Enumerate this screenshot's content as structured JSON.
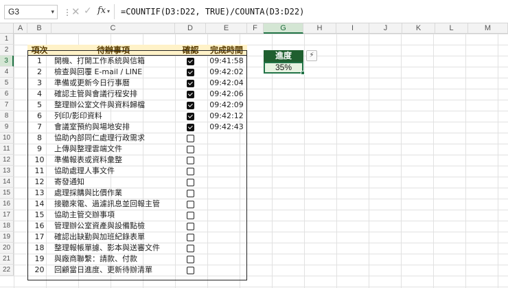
{
  "formula_bar": {
    "name_box": "G3",
    "fx": "fx",
    "formula": "=COUNTIF(D3:D22, TRUE)/COUNTA(D3:D22)"
  },
  "columns": [
    "A",
    "B",
    "C",
    "D",
    "E",
    "F",
    "G",
    "H",
    "I",
    "J",
    "K",
    "L",
    "M"
  ],
  "rows": [
    "1",
    "2",
    "3",
    "4",
    "5",
    "6",
    "7",
    "8",
    "9",
    "10",
    "11",
    "12",
    "13",
    "14",
    "15",
    "16",
    "17",
    "18",
    "19",
    "20",
    "21",
    "22"
  ],
  "table": {
    "headers": {
      "no": "項次",
      "task": "待辦事項",
      "check": "確認",
      "time": "完成時間"
    },
    "items": [
      {
        "no": "1",
        "task": "開機、打開工作系統與信箱",
        "done": true,
        "time": "09:41:58"
      },
      {
        "no": "2",
        "task": "檢查與回覆 E-mail / LINE",
        "done": true,
        "time": "09:42:02"
      },
      {
        "no": "3",
        "task": "準備或更新今日行事曆",
        "done": true,
        "time": "09:42:04"
      },
      {
        "no": "4",
        "task": "確認主管與會議行程安排",
        "done": true,
        "time": "09:42:06"
      },
      {
        "no": "5",
        "task": "整理辦公室文件與資料歸檔",
        "done": true,
        "time": "09:42:09"
      },
      {
        "no": "6",
        "task": "列印/影印資料",
        "done": true,
        "time": "09:42:12"
      },
      {
        "no": "7",
        "task": "會議室預約與場地安排",
        "done": true,
        "time": "09:42:43"
      },
      {
        "no": "8",
        "task": "協助內部同仁處理行政需求",
        "done": false,
        "time": ""
      },
      {
        "no": "9",
        "task": "上傳與整理雲端文件",
        "done": false,
        "time": ""
      },
      {
        "no": "10",
        "task": "準備報表或資料彙整",
        "done": false,
        "time": ""
      },
      {
        "no": "11",
        "task": "協助處理人事文件",
        "done": false,
        "time": ""
      },
      {
        "no": "12",
        "task": "寄發通知",
        "done": false,
        "time": ""
      },
      {
        "no": "13",
        "task": "處理採購與比價作業",
        "done": false,
        "time": ""
      },
      {
        "no": "14",
        "task": "接聽來電、過濾訊息並回報主管",
        "done": false,
        "time": ""
      },
      {
        "no": "15",
        "task": "協助主管交辦事項",
        "done": false,
        "time": ""
      },
      {
        "no": "16",
        "task": "管理辦公室資產與設備點檢",
        "done": false,
        "time": ""
      },
      {
        "no": "17",
        "task": "確認出缺勤與加班紀錄表單",
        "done": false,
        "time": ""
      },
      {
        "no": "18",
        "task": "整理報帳單據、影本與送審文件",
        "done": false,
        "time": ""
      },
      {
        "no": "19",
        "task": "與廠商聯繫：請款、付款",
        "done": false,
        "time": ""
      },
      {
        "no": "20",
        "task": "回顧當日進度、更新待辦清單",
        "done": false,
        "time": ""
      }
    ]
  },
  "progress": {
    "label": "進度",
    "value": "35%"
  },
  "colors": {
    "header_fill": "#fff2c8",
    "progress_header": "#1f5f2f",
    "selection": "#217346"
  }
}
